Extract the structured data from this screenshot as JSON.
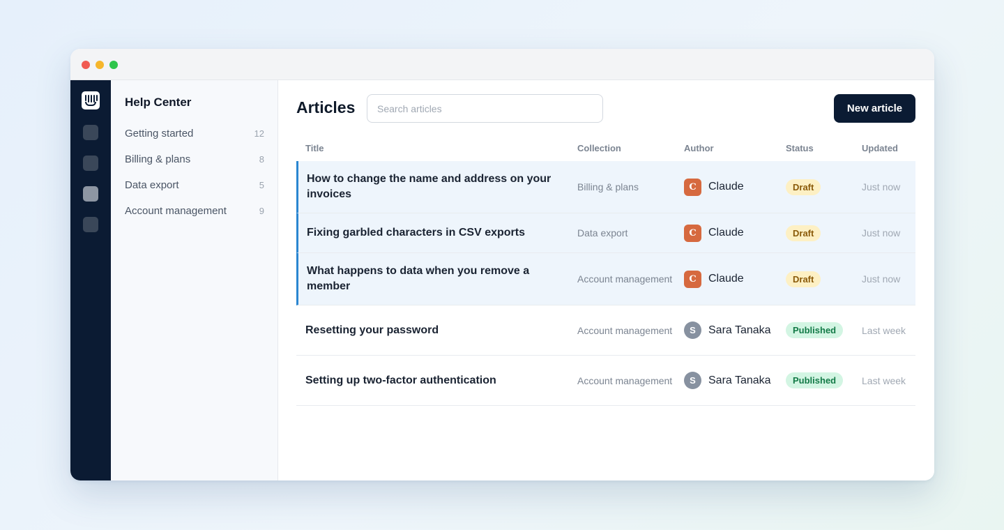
{
  "app": {
    "sidebar_title": "Help Center",
    "collections": [
      {
        "label": "Getting started",
        "count": "12"
      },
      {
        "label": "Billing & plans",
        "count": "8"
      },
      {
        "label": "Data export",
        "count": "5"
      },
      {
        "label": "Account management",
        "count": "9"
      }
    ]
  },
  "header": {
    "title": "Articles",
    "search_placeholder": "Search articles",
    "new_button": "New article"
  },
  "table": {
    "columns": [
      "Title",
      "Collection",
      "Author",
      "Status",
      "Updated"
    ],
    "rows": [
      {
        "title": "How to change the name and address on your invoices",
        "collection": "Billing & plans",
        "author": "Claude",
        "avatar": "C",
        "status": "Draft",
        "updated": "Just now"
      },
      {
        "title": "Fixing garbled characters in CSV exports",
        "collection": "Data export",
        "author": "Claude",
        "avatar": "C",
        "status": "Draft",
        "updated": "Just now"
      },
      {
        "title": "What happens to data when you remove a member",
        "collection": "Account management",
        "author": "Claude",
        "avatar": "C",
        "status": "Draft",
        "updated": "Just now"
      },
      {
        "title": "Resetting your password",
        "collection": "Account management",
        "author": "Sara Tanaka",
        "avatar": "S",
        "status": "Published",
        "updated": "Last week"
      },
      {
        "title": "Setting up two-factor authentication",
        "collection": "Account management",
        "author": "Sara Tanaka",
        "avatar": "S",
        "status": "Published",
        "updated": "Last week"
      }
    ]
  },
  "colors": {
    "rail": "#0b1b33",
    "primary_button": "#0b1b33",
    "highlight_accent": "#2a86d1",
    "draft_bg": "#fdf0c4",
    "published_bg": "#d3f5e3"
  },
  "icons": [
    "app-logo-icon",
    "nav-icon"
  ]
}
